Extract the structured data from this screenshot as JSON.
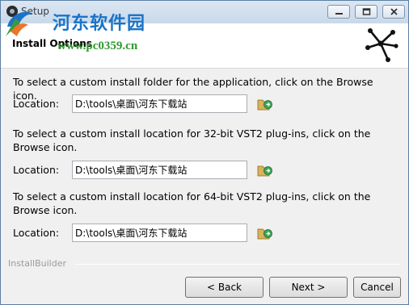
{
  "window": {
    "title": "Setup"
  },
  "watermark": {
    "site_name": "河东软件园",
    "url": "www.pc0359.cn"
  },
  "header": {
    "title": "Install Options"
  },
  "sections": [
    {
      "instruction": "To select a custom install folder for the application, click on the Browse icon.",
      "label": "Location:",
      "value": "D:\\tools\\桌面\\河东下载站"
    },
    {
      "instruction": "To select a custom install location for 32-bit VST2 plug-ins, click on the Browse icon.",
      "label": "Location:",
      "value": "D:\\tools\\桌面\\河东下载站"
    },
    {
      "instruction": "To select a custom install location for 64-bit VST2 plug-ins, click on the Browse icon.",
      "label": "Location:",
      "value": "D:\\tools\\桌面\\河东下载站"
    }
  ],
  "footer": {
    "brand": "InstallBuilder",
    "back_label": "< Back",
    "next_label": "Next >",
    "cancel_label": "Cancel"
  },
  "colors": {
    "window_border": "#5a7fa3",
    "watermark_blue": "#1a73c8",
    "watermark_green": "#2e9a2e",
    "header_bg": "#ffffff",
    "dialog_bg": "#f0f0f0"
  },
  "icons": [
    "app-icon",
    "minimize-icon",
    "maximize-icon",
    "close-icon",
    "brand-logo-icon",
    "folder-browse-icon"
  ]
}
